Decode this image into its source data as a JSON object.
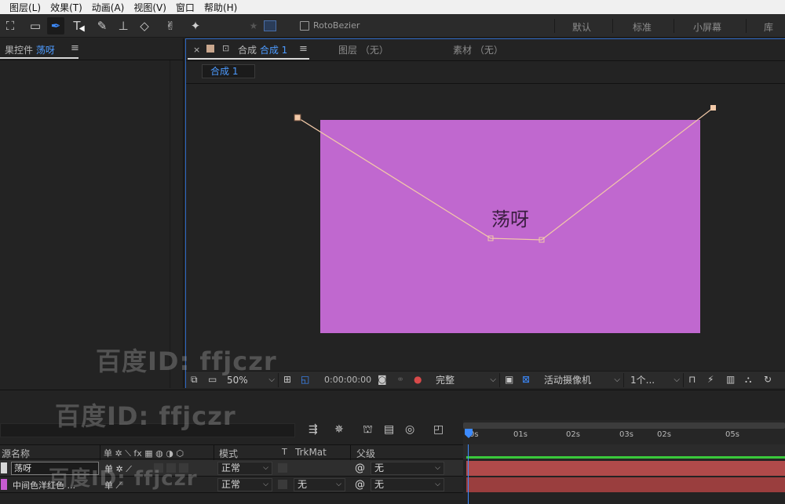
{
  "menu": [
    "图层(L)",
    "效果(T)",
    "动画(A)",
    "视图(V)",
    "窗口",
    "帮助(H)"
  ],
  "toolbar": {
    "tools": [
      {
        "name": "pan-behind-icon",
        "glyph": "⛶"
      },
      {
        "name": "rectangle-tool-icon",
        "glyph": "▭"
      },
      {
        "name": "pen-tool-icon",
        "glyph": "✒"
      },
      {
        "name": "type-tool-icon",
        "glyph": "T"
      },
      {
        "name": "brush-tool-icon",
        "glyph": "✎"
      },
      {
        "name": "clone-stamp-icon",
        "glyph": "⊥"
      },
      {
        "name": "eraser-icon",
        "glyph": "◇"
      },
      {
        "name": "roto-brush-icon",
        "glyph": "✌"
      },
      {
        "name": "puppet-pin-icon",
        "glyph": "✦"
      }
    ],
    "roto_label": "RotoBezier",
    "workspaces": [
      "默认",
      "标准",
      "小屏幕",
      "库"
    ]
  },
  "effects_panel": {
    "tab_prefix": "果控件",
    "tab_layer": "荡呀",
    "menu_glyph": "≡"
  },
  "comp_panel": {
    "close_glyph": "×",
    "lock_glyph": "🔓",
    "title_prefix": "合成",
    "title_name": "合成 1",
    "menu_glyph": "≡",
    "layer_tab": "图层 （无）",
    "footage_tab": "素材 （无）",
    "breadcrumb": "合成 1",
    "solid_color": "#c068cf",
    "text_layer": "荡呀",
    "bottom_bar": {
      "zoom": "50%",
      "timecode": "0:00:00:00",
      "resolution": "完整",
      "camera": "活动摄像机",
      "views": "1个..."
    }
  },
  "timeline": {
    "columns": {
      "source_name": "源名称",
      "mode": "模式",
      "t": "T",
      "trkmat": "TrkMat",
      "parent": "父级"
    },
    "switch_glyphs": "单 ✲ ⟍ fx ▦ ◍ ◑ ⬡",
    "ruler_ticks": [
      "0s",
      "01s",
      "02s",
      "03s",
      "02s",
      "05s"
    ],
    "layers": [
      {
        "name": "荡呀",
        "color": "#d7d7d7",
        "switch_glyph": "单 ✲ ⟋",
        "mode": "正常",
        "trkmat": "",
        "parent": "无",
        "track_color": "#b04a4a"
      },
      {
        "name": "中间色洋红色 ...",
        "color": "#c75bd0",
        "switch_glyph": "单   ⟋",
        "mode": "正常",
        "trkmat": "无",
        "parent": "无",
        "track_color": "#9a3e3e"
      }
    ]
  },
  "watermark": "百度ID: ffjczr"
}
